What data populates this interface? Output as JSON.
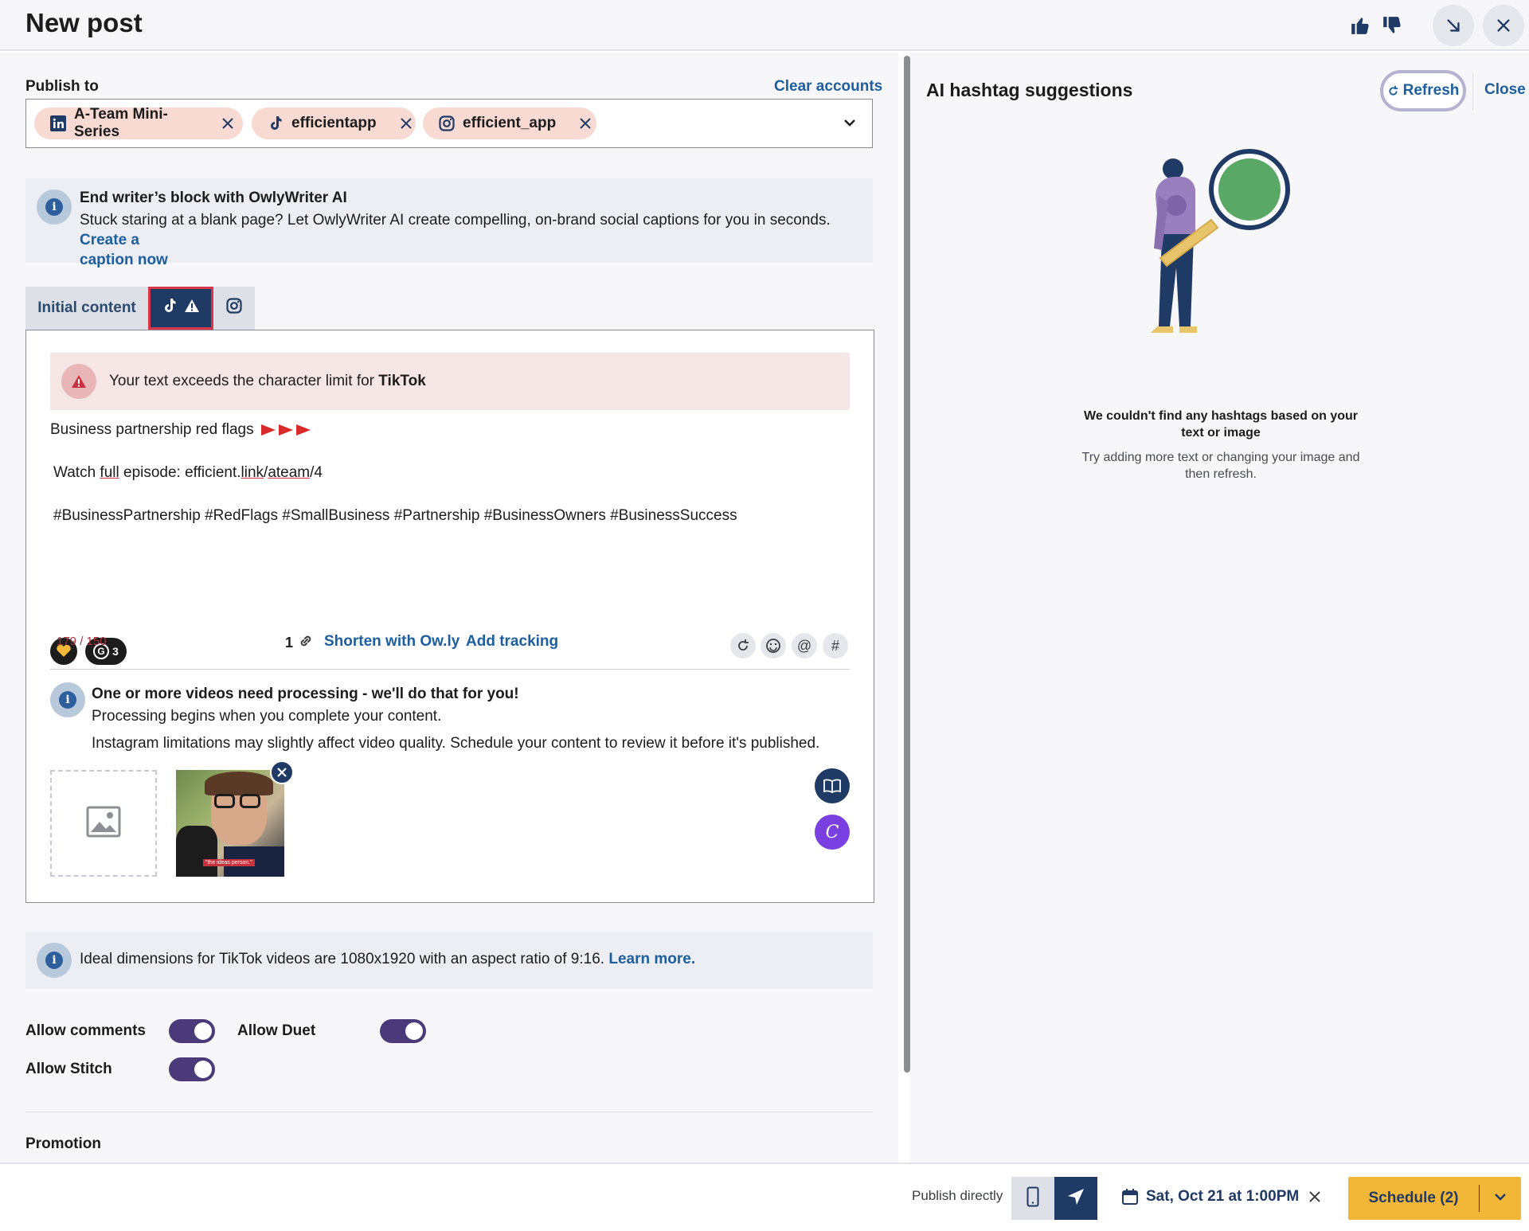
{
  "header": {
    "title": "New post"
  },
  "publish": {
    "label": "Publish to",
    "clear_label": "Clear accounts",
    "accounts": [
      "A-Team Mini-Series",
      "efficientapp",
      "efficient_app"
    ]
  },
  "owly": {
    "title": "End writer’s block with OwlyWriter AI",
    "text": "Stuck staring at a blank page? Let OwlyWriter AI create compelling, on-brand social captions for you in seconds.",
    "link1": "Create a",
    "link2": "caption now"
  },
  "tabs": {
    "initial": "Initial content"
  },
  "warning": {
    "text": "Your text exceeds the character limit for",
    "network": "TikTok"
  },
  "post": {
    "line1": "Business partnership red flags",
    "watch_a": "Watch",
    "watch_full": "full",
    "watch_b": "episode: efficient.",
    "watch_link": "link",
    "watch_slash": "/",
    "watch_ateam": "ateam",
    "watch_end": "/4",
    "hashtags": "#BusinessPartnership #RedFlags  #SmallBusiness #Partnership #BusinessOwners #BusinessSuccess"
  },
  "composer": {
    "grammarly_count": "3",
    "char_count": "179 / 150",
    "link_count": "1",
    "shorten": "Shorten with Ow.ly",
    "tracking": "Add tracking",
    "at": "@",
    "hash": "#"
  },
  "video": {
    "title": "One or more videos need processing - we'll do that for you!",
    "line1": "Processing begins when you complete your content.",
    "line2": "Instagram limitations may slightly affect video quality. Schedule your content to review it before it's published.",
    "caption": "\"the ideas person.\""
  },
  "dims": {
    "text": "Ideal dimensions for TikTok videos are 1080x1920 with an aspect ratio of 9:16.",
    "link": "Learn more."
  },
  "toggles": {
    "comments": "Allow comments",
    "duet": "Allow Duet",
    "stitch": "Allow Stitch"
  },
  "promotion": "Promotion",
  "ai": {
    "title": "AI hashtag suggestions",
    "refresh": "Refresh",
    "close": "Close",
    "empty_title": "We couldn't find any hashtags based on your text or image",
    "empty_text": "Try adding more text or changing your image and then refresh."
  },
  "footer": {
    "publish_directly": "Publish directly",
    "date": "Sat, Oct 21 at 1:00PM",
    "schedule": "Schedule (2)"
  },
  "colors": {
    "brand_dark": "#1f3a64",
    "link": "#1c5e9e",
    "schedule": "#f2b738",
    "toggle": "#4a3a79",
    "error": "#d8374a"
  }
}
